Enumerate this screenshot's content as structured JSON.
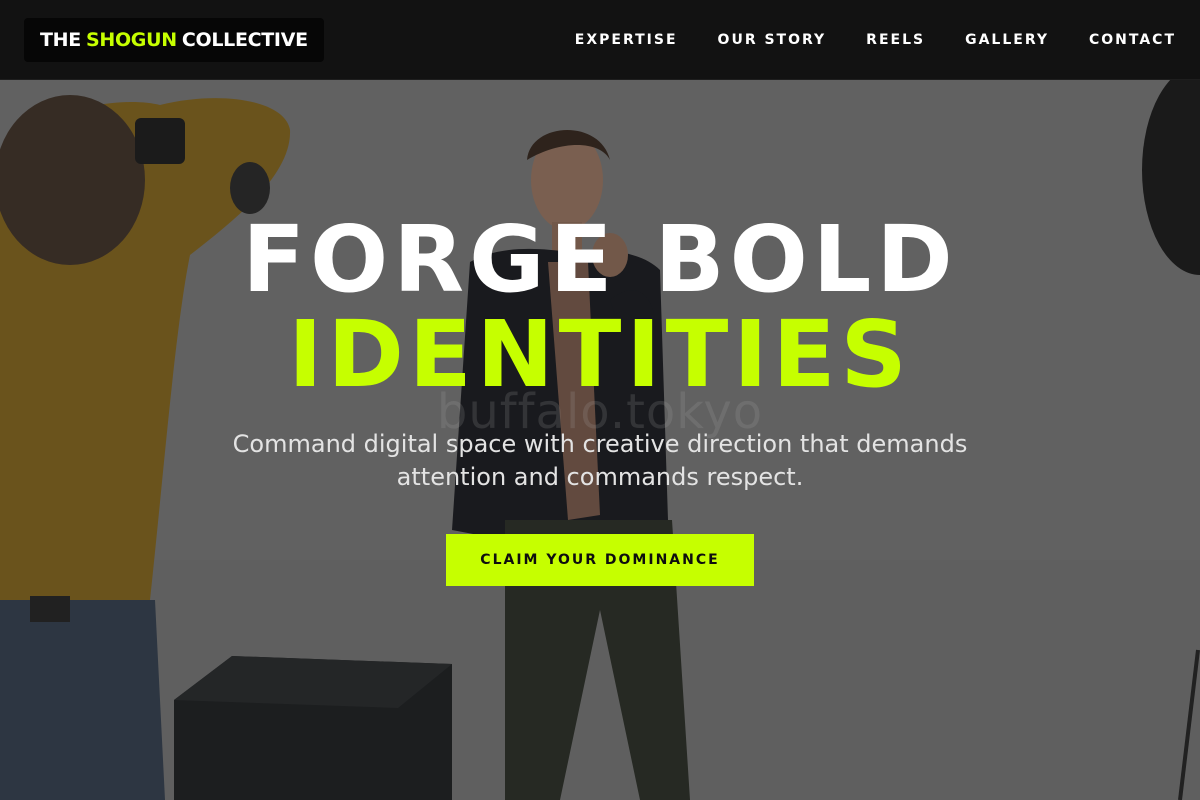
{
  "brand": {
    "prefix": "THE",
    "highlight": "SHOGUN",
    "suffix": "COLLECTIVE"
  },
  "nav": {
    "items": [
      {
        "label": "EXPERTISE"
      },
      {
        "label": "OUR STORY"
      },
      {
        "label": "REELS"
      },
      {
        "label": "GALLERY"
      },
      {
        "label": "CONTACT"
      }
    ]
  },
  "hero": {
    "headline_line1": "FORGE BOLD",
    "headline_line2": "IDENTITIES",
    "subtitle_line1": "Command digital space with creative direction that demands",
    "subtitle_line2": "attention and commands respect.",
    "cta_label": "CLAIM YOUR DOMINANCE",
    "watermark": "buffalo.tokyo"
  },
  "colors": {
    "accent": "#c6ff00",
    "navbar_bg": "#121212",
    "text_primary": "#ffffff"
  }
}
